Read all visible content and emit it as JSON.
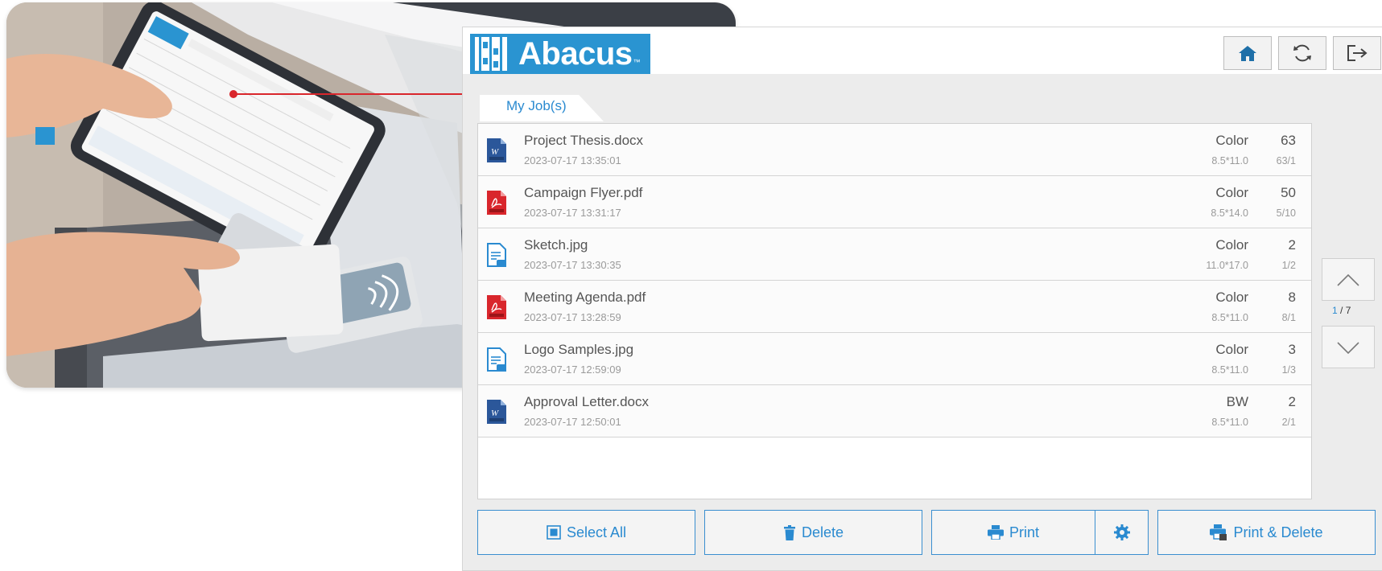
{
  "app": {
    "logo_text": "Abacus",
    "logo_tm": "™",
    "header_buttons": [
      {
        "icon": "home-icon"
      },
      {
        "icon": "refresh-icon"
      },
      {
        "icon": "logout-icon"
      }
    ],
    "tab_label": "My Job(s)",
    "jobs": [
      {
        "name": "Project Thesis.docx",
        "date": "2023-07-17 13:35:01",
        "color": "Color",
        "paper": "8.5*11.0",
        "count": "63",
        "ratio": "63/1",
        "type": "docx"
      },
      {
        "name": "Campaign Flyer.pdf",
        "date": "2023-07-17 13:31:17",
        "color": "Color",
        "paper": "8.5*14.0",
        "count": "50",
        "ratio": "5/10",
        "type": "pdf"
      },
      {
        "name": "Sketch.jpg",
        "date": "2023-07-17 13:30:35",
        "color": "Color",
        "paper": "11.0*17.0",
        "count": "2",
        "ratio": "1/2",
        "type": "jpg"
      },
      {
        "name": "Meeting Agenda.pdf",
        "date": "2023-07-17 13:28:59",
        "color": "Color",
        "paper": "8.5*11.0",
        "count": "8",
        "ratio": "8/1",
        "type": "pdf"
      },
      {
        "name": "Logo Samples.jpg",
        "date": "2023-07-17 12:59:09",
        "color": "Color",
        "paper": "8.5*11.0",
        "count": "3",
        "ratio": "1/3",
        "type": "jpg"
      },
      {
        "name": "Approval Letter.docx",
        "date": "2023-07-17 12:50:01",
        "color": "BW",
        "paper": "8.5*11.0",
        "count": "2",
        "ratio": "2/1",
        "type": "docx"
      }
    ],
    "pager": {
      "current": "1",
      "separator": " / ",
      "total": "7"
    },
    "actions": {
      "select_all": "Select All",
      "delete": "Delete",
      "print": "Print",
      "print_delete": "Print & Delete"
    }
  },
  "colors": {
    "brand_blue": "#2a94d1",
    "link_blue": "#2a8ad0",
    "connector_red": "#d9262c",
    "pdf_red": "#d9262c",
    "doc_blue": "#2b579a"
  }
}
